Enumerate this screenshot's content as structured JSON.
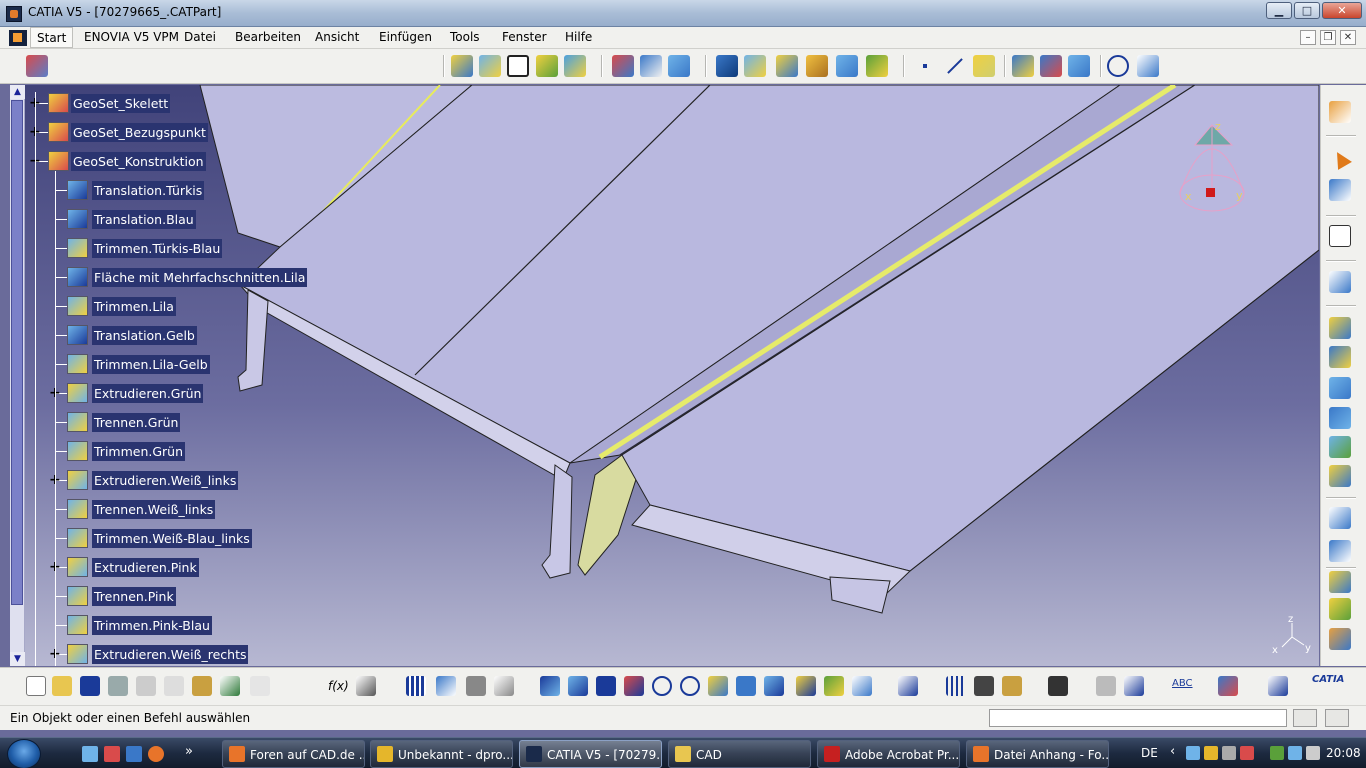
{
  "window": {
    "title": "CATIA V5 - [70279665_.CATPart]",
    "minimize": "▁",
    "maximize": "□",
    "close": "✕"
  },
  "menu": {
    "items": [
      "Start",
      "ENOVIA V5 VPM",
      "Datei",
      "Bearbeiten",
      "Ansicht",
      "Einfügen",
      "Tools",
      "Fenster",
      "Hilfe"
    ],
    "mdi_minimize": "–",
    "mdi_restore": "❐",
    "mdi_close": "✕"
  },
  "tree": {
    "items": [
      {
        "label": "GeoSet_Skelett",
        "level": 0,
        "expander": "+",
        "icon": "geoset-icon"
      },
      {
        "label": "GeoSet_Bezugspunkt",
        "level": 0,
        "expander": "+",
        "icon": "geoset-icon"
      },
      {
        "label": "GeoSet_Konstruktion",
        "level": 0,
        "expander": "−",
        "icon": "geoset-icon"
      },
      {
        "label": "Translation.Türkis",
        "level": 1,
        "expander": "",
        "icon": "translation-icon"
      },
      {
        "label": "Translation.Blau",
        "level": 1,
        "expander": "",
        "icon": "translation-icon"
      },
      {
        "label": "Trimmen.Türkis-Blau",
        "level": 1,
        "expander": "",
        "icon": "trim-icon"
      },
      {
        "label": "Fläche mit Mehrfachschnitten.Lila",
        "level": 1,
        "expander": "",
        "icon": "multisection-surface-icon"
      },
      {
        "label": "Trimmen.Lila",
        "level": 1,
        "expander": "",
        "icon": "trim-icon"
      },
      {
        "label": "Translation.Gelb",
        "level": 1,
        "expander": "",
        "icon": "translation-icon"
      },
      {
        "label": "Trimmen.Lila-Gelb",
        "level": 1,
        "expander": "",
        "icon": "trim-icon"
      },
      {
        "label": "Extrudieren.Grün",
        "level": 1,
        "expander": "+",
        "icon": "extrude-icon"
      },
      {
        "label": "Trennen.Grün",
        "level": 1,
        "expander": "",
        "icon": "split-icon"
      },
      {
        "label": "Trimmen.Grün",
        "level": 1,
        "expander": "",
        "icon": "trim-icon"
      },
      {
        "label": "Extrudieren.Weiß_links",
        "level": 1,
        "expander": "+",
        "icon": "extrude-icon"
      },
      {
        "label": "Trennen.Weiß_links",
        "level": 1,
        "expander": "",
        "icon": "split-icon"
      },
      {
        "label": "Trimmen.Weiß-Blau_links",
        "level": 1,
        "expander": "",
        "icon": "trim-icon"
      },
      {
        "label": "Extrudieren.Pink",
        "level": 1,
        "expander": "+",
        "icon": "extrude-icon"
      },
      {
        "label": "Trennen.Pink",
        "level": 1,
        "expander": "",
        "icon": "split-icon"
      },
      {
        "label": "Trimmen.Pink-Blau",
        "level": 1,
        "expander": "",
        "icon": "trim-icon"
      },
      {
        "label": "Extrudieren.Weiß_rechts",
        "level": 1,
        "expander": "+",
        "icon": "extrude-icon"
      }
    ]
  },
  "compass": {
    "x_label": "x",
    "y_label": "y",
    "z_label": "z"
  },
  "axis_triad": {
    "x_label": "x",
    "y_label": "y",
    "z_label": "z"
  },
  "bottom_toolbar": {
    "fx_label": "f(x)",
    "abc_label": "ABC",
    "catia_logo": "CATIA"
  },
  "status": {
    "message": "Ein Objekt oder einen Befehl auswählen",
    "command_input": ""
  },
  "taskbar": {
    "tasks": [
      {
        "label": "Foren auf CAD.de ...",
        "icon_color": "#e8742a",
        "active": false
      },
      {
        "label": "Unbekannt - dpro...",
        "icon_color": "#e5b62b",
        "active": false
      },
      {
        "label": "CATIA V5 - [70279...",
        "icon_color": "#1a2a4a",
        "active": true
      },
      {
        "label": "CAD",
        "icon_color": "#e8c650",
        "active": false
      },
      {
        "label": "Adobe Acrobat Pr...",
        "icon_color": "#c62020",
        "active": false
      },
      {
        "label": "Datei Anhang - Fo...",
        "icon_color": "#e8742a",
        "active": false
      }
    ],
    "overflow": "»",
    "language": "DE",
    "tray_expand": "‹",
    "clock": "20:08"
  },
  "colors": {
    "tree_label_bg": "#2a3470",
    "viewport_top": "#41437a",
    "viewport_bottom": "#b7b8d2",
    "part_face": "#b5b5dc",
    "highlight_yellow": "#e6eb6a"
  }
}
